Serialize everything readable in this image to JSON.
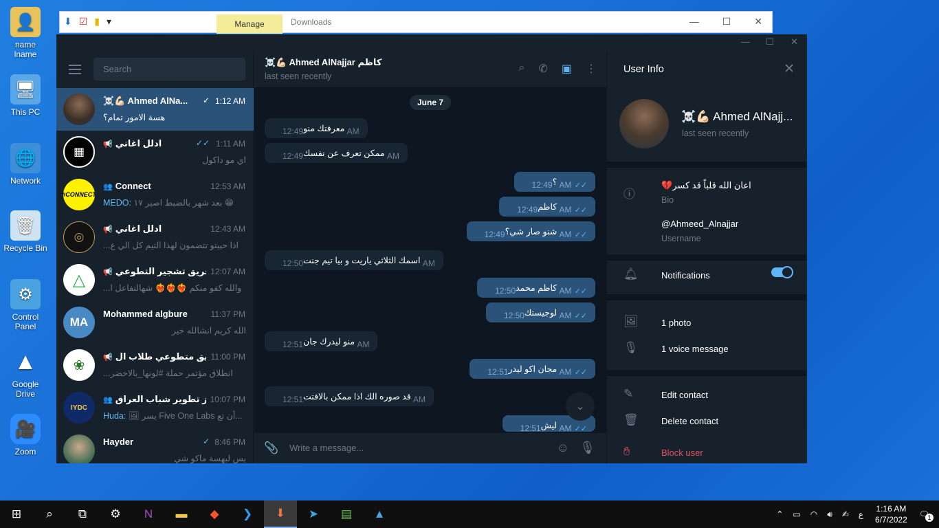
{
  "desktop": {
    "icons": [
      {
        "label": "name lname",
        "icon": "user-folder-icon"
      },
      {
        "label": "This PC",
        "icon": "computer-icon"
      },
      {
        "label": "Network",
        "icon": "network-icon"
      },
      {
        "label": "Recycle Bin",
        "icon": "recycle-bin-icon"
      },
      {
        "label": "Control Panel",
        "icon": "control-panel-icon"
      },
      {
        "label": "Google Drive",
        "icon": "google-drive-icon"
      },
      {
        "label": "Zoom",
        "icon": "zoom-icon"
      }
    ]
  },
  "explorer": {
    "manage_tab": "Manage",
    "title": "Downloads"
  },
  "left": {
    "search_placeholder": "Search",
    "chats": [
      {
        "name": "☠️💪🏻 Ahmed AlNa...",
        "time": "1:12 AM",
        "check": "✓",
        "preview": "هسة الامور تمام؟",
        "avatar": "photo",
        "active": true
      },
      {
        "name": "ادلل اغاني",
        "time": "1:11 AM",
        "check": "✓✓",
        "preview": "اي مو داكول",
        "avatar": "photo",
        "type": "channel"
      },
      {
        "name": "Connect",
        "time": "12:53 AM",
        "check": "",
        "sender": "MEDO:",
        "preview": "بعد شهر بالضبط اصير ١٧ 😁",
        "avatar": "#CONNECT",
        "type": "group"
      },
      {
        "name": "ادلل اغاني",
        "time": "12:43 AM",
        "check": "",
        "preview": "اذا حبيتو تتضمون لهذا التيم  كل الي ع...",
        "avatar": "photo",
        "type": "channel"
      },
      {
        "name": "فريق تشجير التطوعي",
        "time": "12:07 AM",
        "check": "",
        "preview": "والله كفو منكم ❤️‍🔥❤️‍🔥❤️‍🔥 شهالتفاعل ا...",
        "avatar": "logo",
        "type": "channel"
      },
      {
        "name": "Mohammed algbure",
        "time": "11:37 PM",
        "check": "",
        "preview": "الله كريم انشالله خير",
        "avatar": "MA",
        "type": ""
      },
      {
        "name": "فريق متطوعي طلاب ال...",
        "time": "11:00 PM",
        "check": "",
        "preview": "انطلاق مؤتمر حملة #لونها_بالاخضر...",
        "avatar": "logo",
        "type": "channel"
      },
      {
        "name": "مركز تطوير شباب العراق",
        "time": "10:07 PM",
        "check": "",
        "sender": "Huda:",
        "preview": "🖼 يسر Five One Labs أن تع...",
        "avatar": "IYDC",
        "type": "group"
      },
      {
        "name": "Hayder",
        "time": "8:46 PM",
        "check": "✓",
        "preview": "بس لبهسة ماكو شي",
        "avatar": "photo",
        "type": ""
      }
    ]
  },
  "chat": {
    "title": "☠️💪🏻 Ahmed AlNajjar كاظم",
    "status": "last seen recently",
    "date_pill": "June 7",
    "messages": [
      {
        "dir": "in",
        "text": "معرفتك منو",
        "time": "12:49 AM"
      },
      {
        "dir": "in",
        "text": "ممكن تعرف عن نفسك",
        "time": "12:49 AM"
      },
      {
        "dir": "out",
        "text": "؟",
        "time": "12:49 AM"
      },
      {
        "dir": "out",
        "text": "كاظم",
        "time": "12:49 AM"
      },
      {
        "dir": "out",
        "text": "شنو صار شي؟",
        "time": "12:49 AM"
      },
      {
        "dir": "in",
        "text": "اسمك الثلاثي ياريت و بيا تيم جنت",
        "time": "12:50 AM"
      },
      {
        "dir": "out",
        "text": "كاظم محمد",
        "time": "12:50 AM"
      },
      {
        "dir": "out",
        "text": "لوجيستك",
        "time": "12:50 AM"
      },
      {
        "dir": "in",
        "text": "منو ليدرك جان",
        "time": "12:51 AM"
      },
      {
        "dir": "out",
        "text": "مجان اكو ليدر",
        "time": "12:51 AM"
      },
      {
        "dir": "in",
        "text": "قد صوره الك اذا ممكن بالافتت",
        "time": "12:51 AM"
      },
      {
        "dir": "out",
        "text": "ليش",
        "time": "12:51 AM"
      }
    ],
    "composer_placeholder": "Write a message..."
  },
  "user_info": {
    "header": "User Info",
    "name": "☠️💪🏻 Ahmed AlNajj...",
    "status": "last seen recently",
    "bio": "💔اعان الله قلباً قد كسر",
    "bio_label": "Bio",
    "username": "@Ahmeed_Alnajjar",
    "username_label": "Username",
    "notifications": "Notifications",
    "notifications_on": true,
    "photos": "1 photo",
    "voice": "1 voice message",
    "edit": "Edit contact",
    "delete": "Delete contact",
    "block": "Block user"
  },
  "taskbar": {
    "time": "1:16 AM",
    "date": "6/7/2022",
    "lang": "ع",
    "notifications_count": "1"
  }
}
